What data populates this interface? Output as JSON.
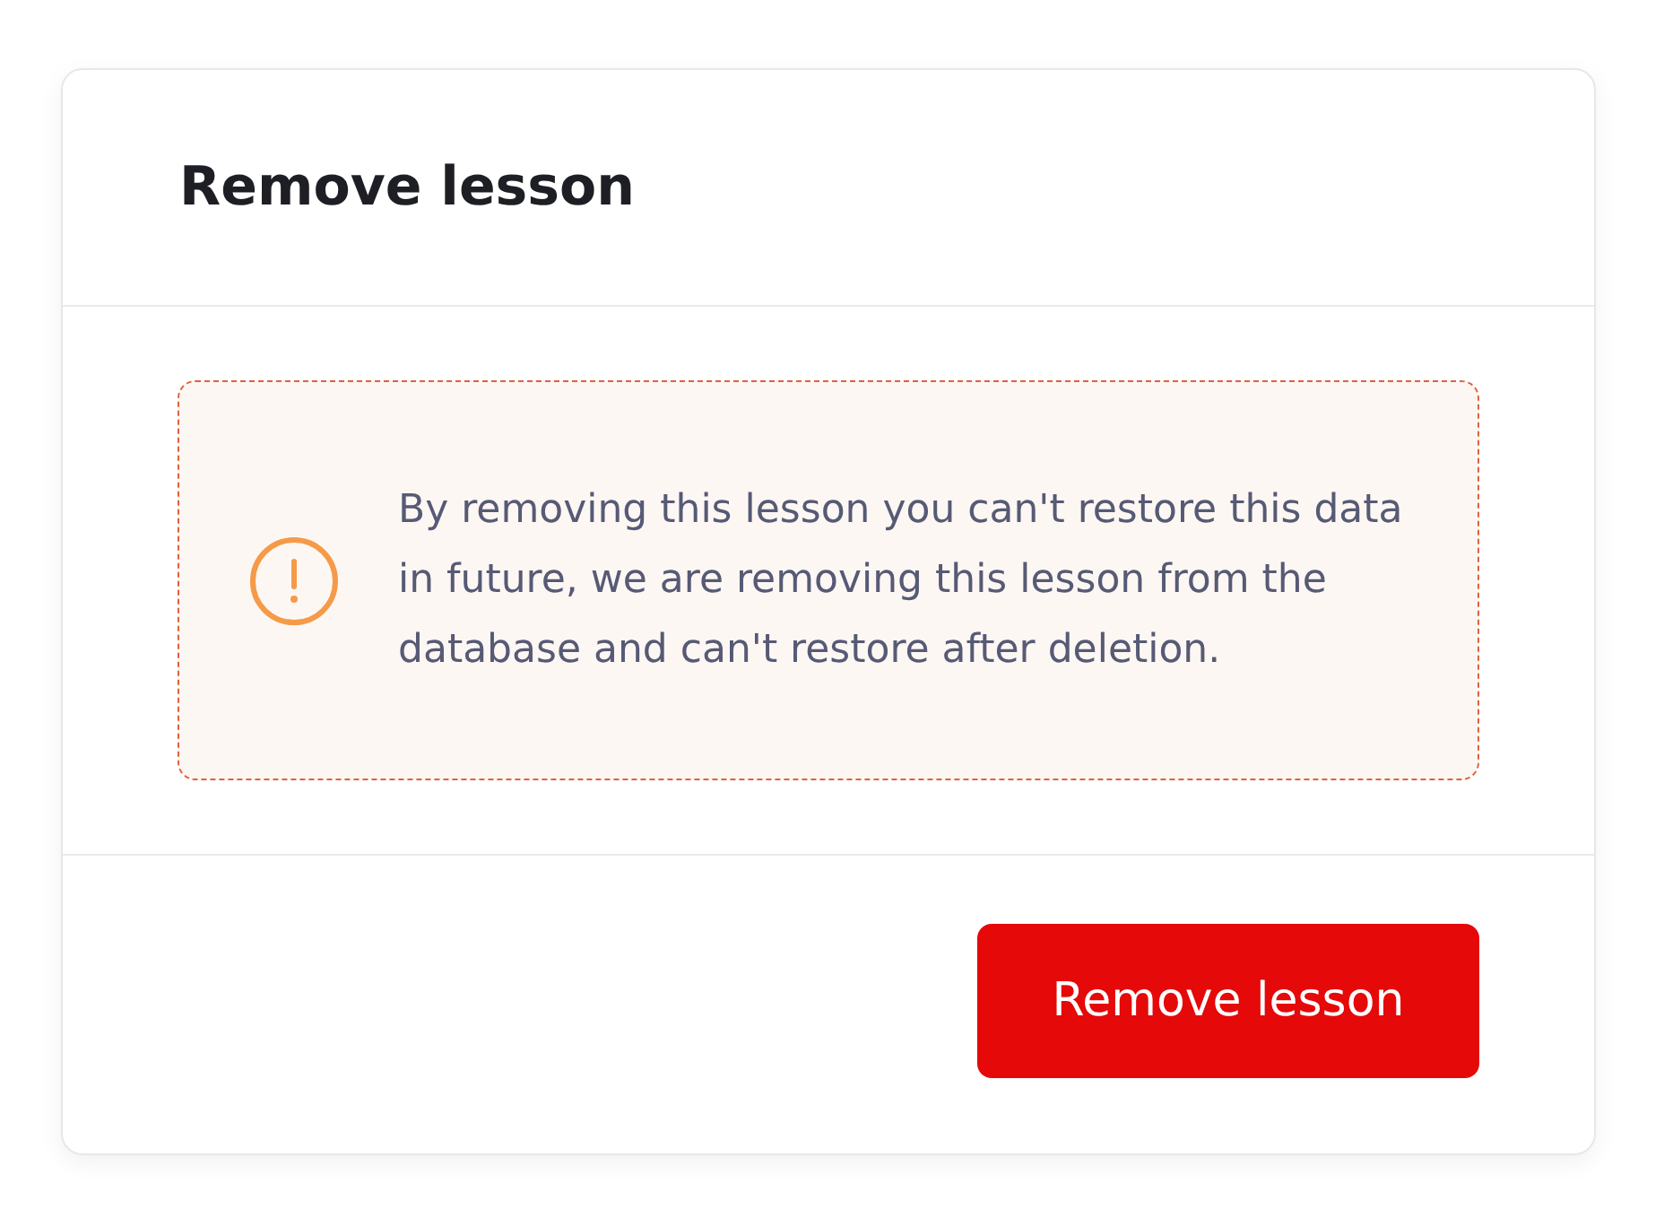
{
  "dialog": {
    "title": "Remove lesson",
    "warning": {
      "text": "By removing this lesson you can't restore this data in future, we are removing this lesson from the database and can't restore after deletion."
    },
    "buttons": [
      {
        "label": "Remove lesson",
        "kind": "danger"
      }
    ]
  }
}
